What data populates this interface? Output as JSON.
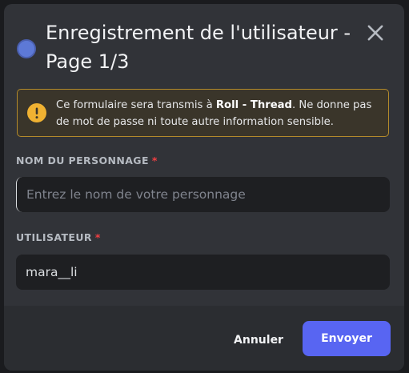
{
  "modal": {
    "title": "Enregistrement de l'utilisateur - Page 1/3",
    "close_icon": "close-icon",
    "avatar_color": "#5d79d6"
  },
  "warning": {
    "icon": "warning-icon",
    "text_before": "Ce formulaire sera transmis à ",
    "bold": "Roll - Thread",
    "text_after": ". Ne donne pas de mot de passe ni toute autre information sensible.",
    "border_color": "#b38a2b"
  },
  "fields": [
    {
      "label": "NOM DU PERSONNAGE",
      "required_mark": "*",
      "value": "",
      "placeholder": "Entrez le nom de votre personnage"
    },
    {
      "label": "UTILISATEUR",
      "required_mark": "*",
      "value": "mara__li",
      "placeholder": ""
    }
  ],
  "footer": {
    "cancel_label": "Annuler",
    "submit_label": "Envoyer",
    "submit_color": "#5865f2"
  }
}
